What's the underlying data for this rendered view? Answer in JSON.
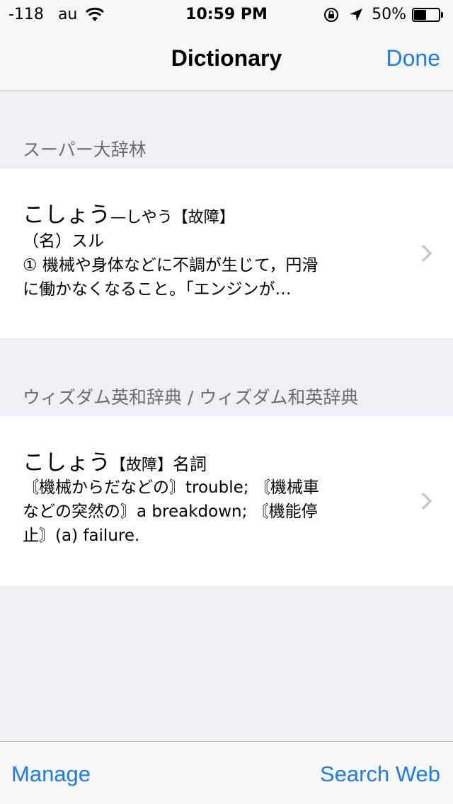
{
  "status_bar": {
    "signal": "-118",
    "carrier": "au",
    "time": "10:59 PM",
    "battery_pct": "50%",
    "battery_level": 0.5
  },
  "nav": {
    "title": "Dictionary",
    "done": "Done"
  },
  "sections": [
    {
      "header": "スーパー大辞林",
      "entry": {
        "headword": "こしょう",
        "reading": "—しやう",
        "kanji": "【故障】",
        "pos": "（名）スル",
        "lines": [
          "① 機械や身体などに不調が生じて，円滑",
          "に働かなくなること。「エンジンが…"
        ]
      }
    },
    {
      "header": "ウィズダム英和辞典 / ウィズダム和英辞典",
      "entry": {
        "headword": "こしょう",
        "kanji": "【故障】",
        "pos": "名詞",
        "lines": [
          "〘機械からだなどの〙trouble; 〘機械車",
          "などの突然の〙a breakdown; 〘機能停",
          "止〙(a) failure."
        ]
      }
    }
  ],
  "toolbar": {
    "manage": "Manage",
    "search_web": "Search Web"
  },
  "colors": {
    "accent": "#1a7cf2",
    "background": "#efeff4",
    "header_text": "#6d6d72"
  }
}
